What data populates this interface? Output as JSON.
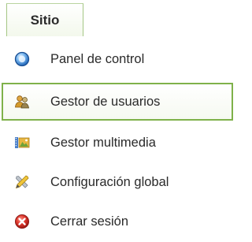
{
  "menubar": {
    "tab_label": "Sitio"
  },
  "menu": {
    "items": [
      {
        "label": "Panel de control",
        "icon": "control-panel-icon"
      },
      {
        "label": "Gestor de usuarios",
        "icon": "users-icon",
        "highlighted": true
      },
      {
        "label": "Gestor multimedia",
        "icon": "media-icon"
      },
      {
        "label": "Configuración global",
        "icon": "tools-icon"
      },
      {
        "label": "Cerrar sesión",
        "icon": "logout-icon"
      }
    ]
  },
  "colors": {
    "accent_green": "#7fb14a",
    "text": "#2a2a2a",
    "logout_red": "#d9322d",
    "panel_blue": "#2f7fd1"
  }
}
